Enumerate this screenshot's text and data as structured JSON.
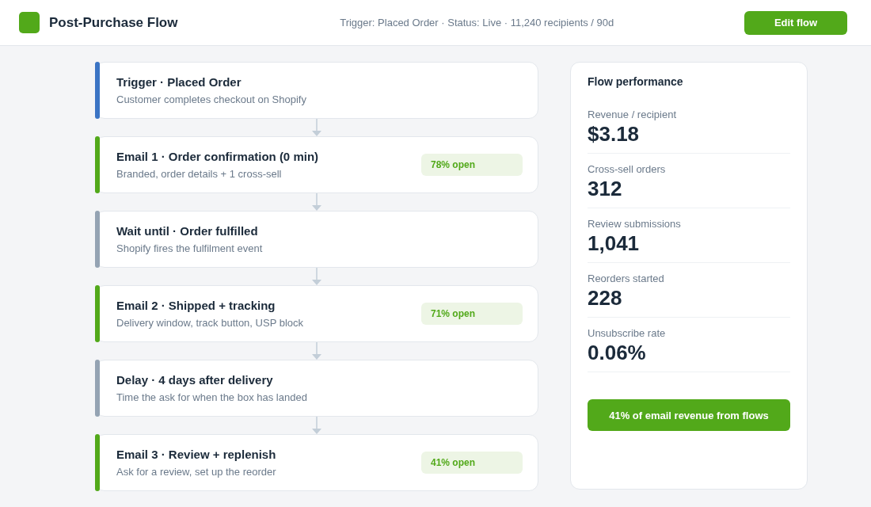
{
  "header": {
    "title": "Post-Purchase Flow",
    "meta": "Trigger: Placed Order · Status: Live · 11,240 recipients / 90d",
    "button": "Edit flow"
  },
  "steps": [
    {
      "title": "Trigger · Placed Order",
      "description": "Customer completes checkout on Shopify",
      "color": "#3b74c4"
    },
    {
      "title": "Email 1 · Order confirmation (0 min)",
      "description": "Branded, order details + 1 cross-sell",
      "color": "#52a91a",
      "badge": "78% open"
    },
    {
      "title": "Wait until · Order fulfilled",
      "description": "Shopify fires the fulfilment event",
      "color": "#94a3b3"
    },
    {
      "title": "Email 2 · Shipped + tracking",
      "description": "Delivery window, track button, USP block",
      "color": "#52a91a",
      "badge": "71% open"
    },
    {
      "title": "Delay · 4 days after delivery",
      "description": "Time the ask for when the box has landed",
      "color": "#94a3b3"
    },
    {
      "title": "Email 3 · Review + replenish",
      "description": "Ask for a review, set up the reorder",
      "color": "#52a91a",
      "badge": "41% open"
    }
  ],
  "performance": {
    "title": "Flow performance",
    "metrics": [
      {
        "label": "Revenue / recipient",
        "value": "$3.18"
      },
      {
        "label": "Cross-sell orders",
        "value": "312"
      },
      {
        "label": "Review submissions",
        "value": "1,041"
      },
      {
        "label": "Reorders started",
        "value": "228"
      },
      {
        "label": "Unsubscribe rate",
        "value": "0.06%"
      }
    ],
    "banner": "41% of email revenue from flows"
  }
}
